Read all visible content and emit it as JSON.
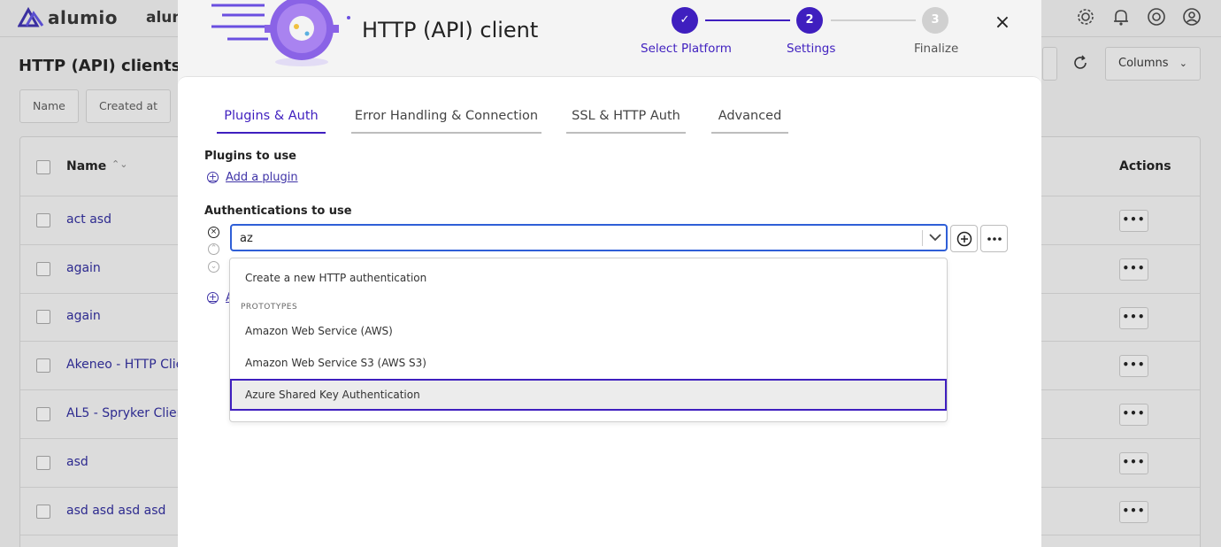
{
  "app": {
    "logo_text": "alumio",
    "app_name": "alum",
    "page_title": "HTTP (API) clients",
    "filters": [
      "Name",
      "Created at"
    ],
    "columns_button": "Columns",
    "table": {
      "header_name": "Name",
      "header_actions": "Actions",
      "rows": [
        "act asd",
        "again",
        "again",
        "Akeneo - HTTP Clie",
        "AL5 - Spryker Clien",
        "asd",
        "asd asd asd asd"
      ],
      "row_action_label": "•••"
    }
  },
  "modal": {
    "title": "HTTP (API) client",
    "steps": [
      {
        "number": "✓",
        "label": "Select Platform",
        "state": "done"
      },
      {
        "number": "2",
        "label": "Settings",
        "state": "current"
      },
      {
        "number": "3",
        "label": "Finalize",
        "state": "pending"
      }
    ],
    "close_icon": "×",
    "tabs": [
      {
        "label": "Plugins & Auth",
        "active": true
      },
      {
        "label": "Error Handling & Connection",
        "active": false
      },
      {
        "label": "SSL & HTTP Auth",
        "active": false
      },
      {
        "label": "Advanced",
        "active": false
      }
    ],
    "plugins_label": "Plugins to use",
    "add_plugin": "Add a plugin",
    "auth_label": "Authentications to use",
    "auth_input_value": "az",
    "add_auth_partial": "A",
    "dropdown": {
      "create_item": "Create a new HTTP authentication",
      "group_label": "PROTOTYPES",
      "options": [
        "Amazon Web Service (AWS)",
        "Amazon Web Service S3 (AWS S3)",
        "Azure Shared Key Authentication"
      ],
      "highlighted_index": 2
    }
  },
  "colors": {
    "accent": "#3f1fbf",
    "link": "#3f33a7",
    "focus_border": "#2f5fd7",
    "step_pending": "#d0d0d0"
  }
}
